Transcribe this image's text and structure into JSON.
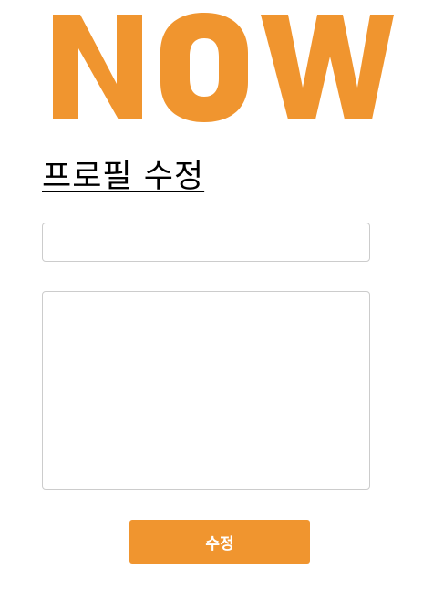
{
  "logo": {
    "text": "NOW",
    "color": "#f0952f"
  },
  "page_title": "프로필 수정",
  "form": {
    "name_value": "",
    "name_placeholder": "",
    "bio_value": "",
    "bio_placeholder": "",
    "submit_label": "수정"
  },
  "colors": {
    "accent": "#f0952f",
    "border": "#cccccc",
    "text": "#000000"
  }
}
